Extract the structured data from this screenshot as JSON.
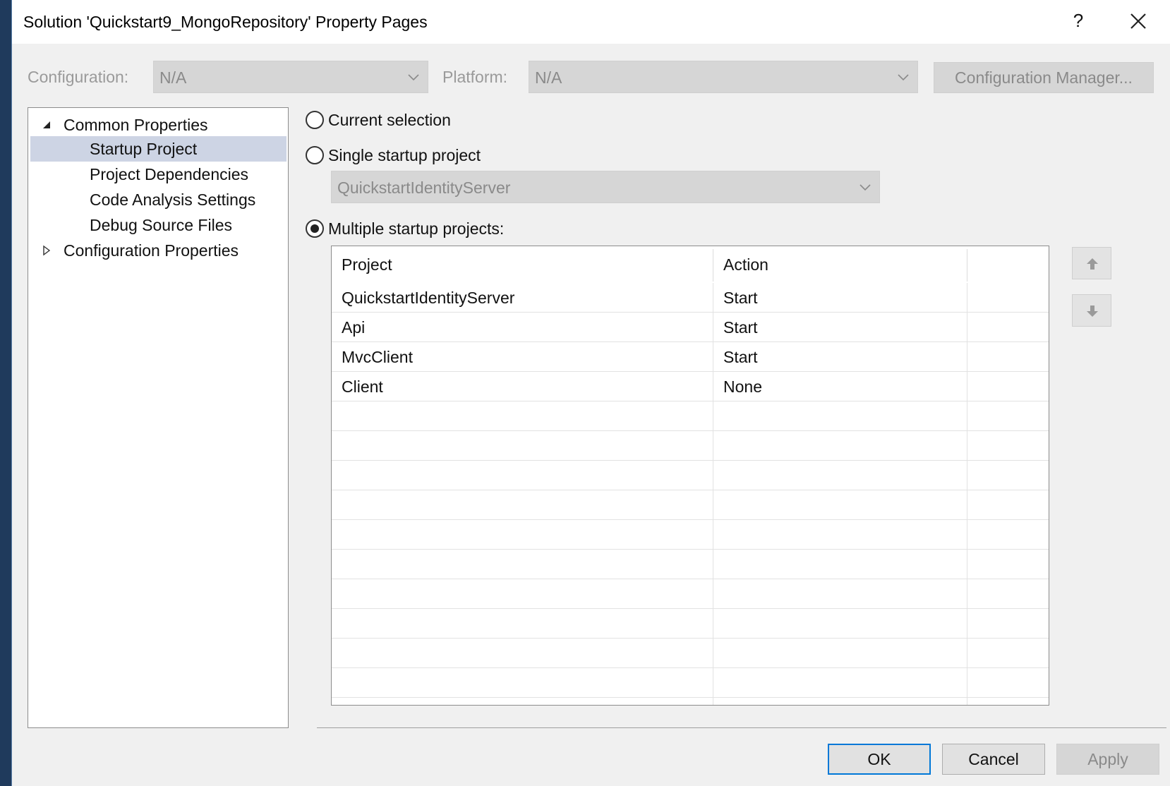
{
  "window": {
    "title": "Solution 'Quickstart9_MongoRepository' Property Pages",
    "help_label": "?"
  },
  "toolbar": {
    "configuration_label": "Configuration:",
    "configuration_value": "N/A",
    "platform_label": "Platform:",
    "platform_value": "N/A",
    "config_manager_label": "Configuration Manager..."
  },
  "tree": {
    "items": [
      {
        "label": "Common Properties",
        "expanded": true
      },
      {
        "label": "Startup Project",
        "selected": true
      },
      {
        "label": "Project Dependencies"
      },
      {
        "label": "Code Analysis Settings"
      },
      {
        "label": "Debug Source Files"
      },
      {
        "label": "Configuration Properties",
        "expanded": false
      }
    ]
  },
  "startup": {
    "current_selection_label": "Current selection",
    "single_startup_label": "Single startup project",
    "single_startup_value": "QuickstartIdentityServer",
    "multiple_startup_label": "Multiple startup projects:",
    "selected_option": "multiple"
  },
  "grid": {
    "columns": [
      "Project",
      "Action"
    ],
    "rows": [
      {
        "project": "QuickstartIdentityServer",
        "action": "Start"
      },
      {
        "project": "Api",
        "action": "Start"
      },
      {
        "project": "MvcClient",
        "action": "Start"
      },
      {
        "project": "Client",
        "action": "None"
      }
    ]
  },
  "buttons": {
    "ok_label": "OK",
    "cancel_label": "Cancel",
    "apply_label": "Apply"
  },
  "colors": {
    "background_desktop": "#1f3a5c",
    "dialog_bg": "#f0f0f0",
    "selected_item_bg": "#cdd4e4",
    "default_button_border": "#0078d7"
  }
}
